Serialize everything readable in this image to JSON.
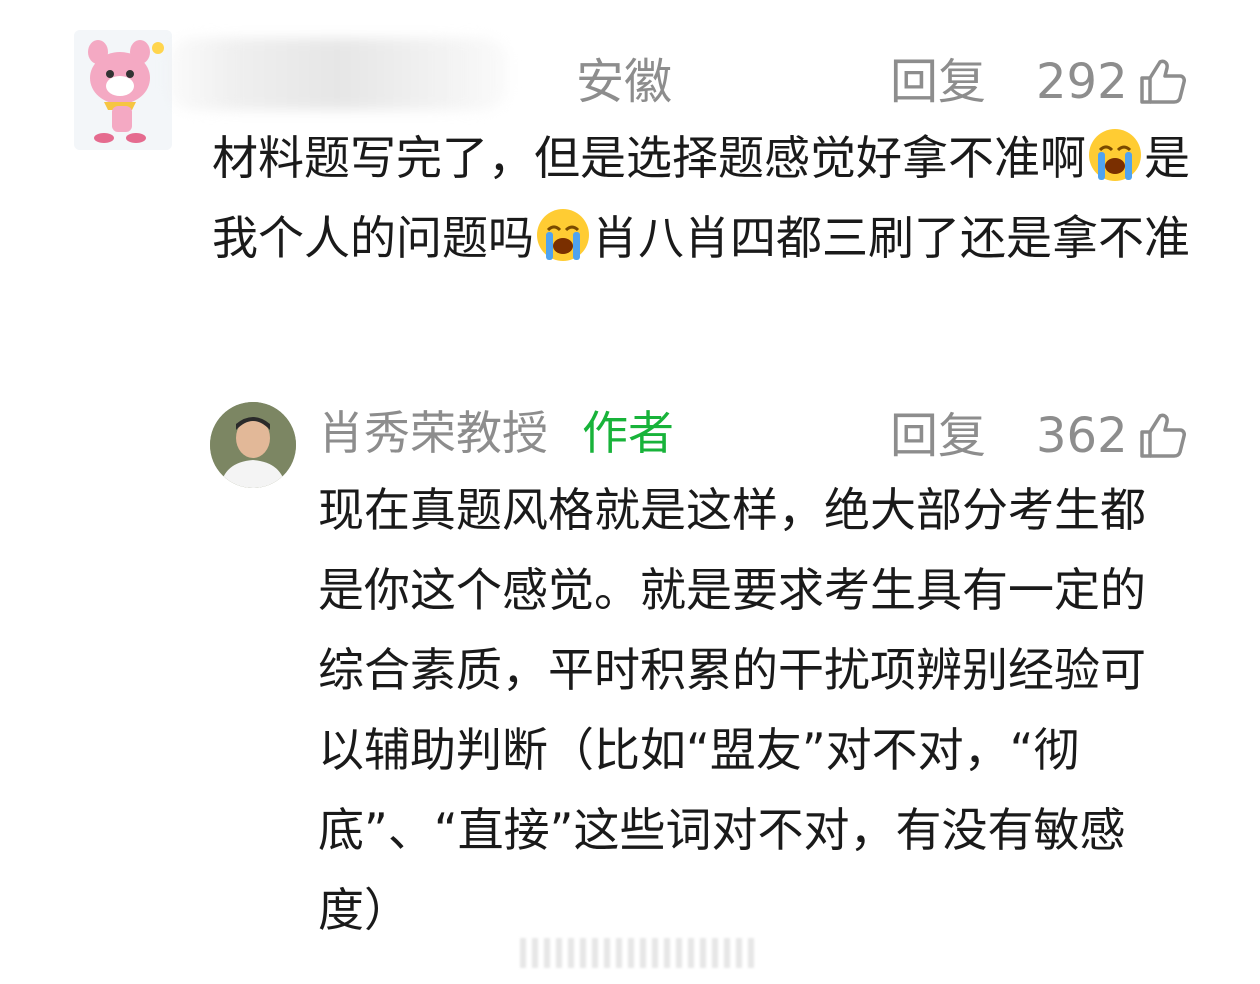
{
  "comment": {
    "location": "安徽",
    "reply_label": "回复",
    "like_count": "292",
    "text_part1": "材料题写完了，但是选择题感觉好拿不准啊",
    "text_part2": "是我个人的问题吗",
    "text_part3": "肖八肖四都三刷了还是拿不准"
  },
  "reply": {
    "author_name": "肖秀荣教授",
    "author_tag": "作者",
    "reply_label": "回复",
    "like_count": "362",
    "text": "现在真题风格就是这样，绝大部分考生都是你这个感觉。就是要求考生具有一定的综合素质，平时积累的干扰项辨别经验可以辅助判断（比如“盟友”对不对，“彻底”、“直接”这些词对不对，有没有敏感度）"
  },
  "colors": {
    "meta_gray": "#8d8d8d",
    "author_tag_green": "#18b33a",
    "text": "#1a1a1a"
  },
  "icons": {
    "like": "thumbs-up-outline-icon",
    "emoji": "crying-face-emoji"
  }
}
